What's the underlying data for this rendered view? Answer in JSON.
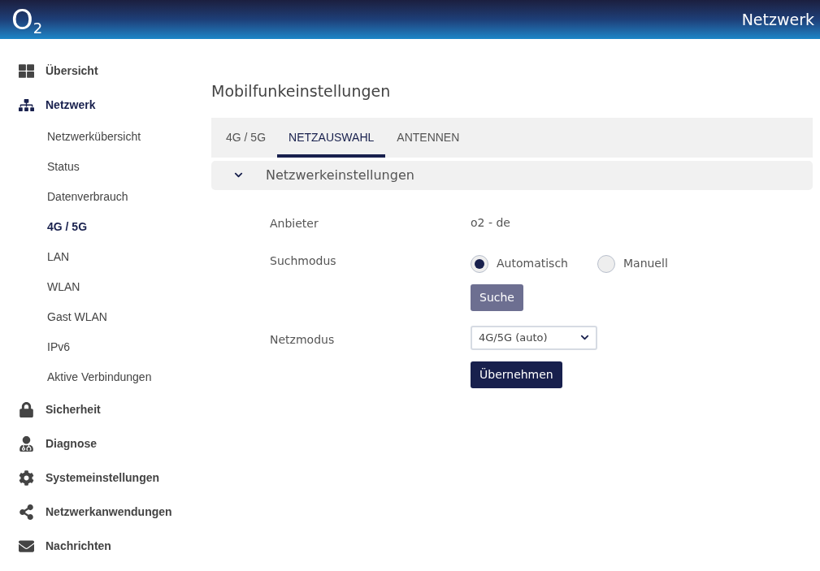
{
  "header": {
    "logo": "O$_{2}$",
    "title": "Netzwerk"
  },
  "sidebar": {
    "items": [
      {
        "label": "Übersicht",
        "selected": false
      },
      {
        "label": "Netzwerk",
        "selected": true,
        "children": [
          {
            "label": "Netzwerkübersicht",
            "selected": false
          },
          {
            "label": "Status",
            "selected": false
          },
          {
            "label": "Datenverbrauch",
            "selected": false
          },
          {
            "label": "4G / 5G",
            "selected": true
          },
          {
            "label": "LAN",
            "selected": false
          },
          {
            "label": "WLAN",
            "selected": false
          },
          {
            "label": "Gast WLAN",
            "selected": false
          },
          {
            "label": "IPv6",
            "selected": false
          },
          {
            "label": "Aktive Verbindungen",
            "selected": false
          }
        ]
      },
      {
        "label": "Sicherheit",
        "selected": false
      },
      {
        "label": "Diagnose",
        "selected": false
      },
      {
        "label": "Systemeinstellungen",
        "selected": false
      },
      {
        "label": "Netzwerkanwendungen",
        "selected": false
      },
      {
        "label": "Nachrichten",
        "selected": false
      }
    ]
  },
  "page_title": "Mobilfunkeinstellungen",
  "tabs": [
    {
      "label": "4G / 5G",
      "selected": false
    },
    {
      "label": "NETZAUSWAHL",
      "selected": true
    },
    {
      "label": "ANTENNEN",
      "selected": false
    }
  ],
  "section": {
    "title": "Netzwerkeinstellungen",
    "expanded": true
  },
  "form": [
    {
      "kind": "text",
      "label": "Anbieter",
      "value": "o2 - de"
    },
    {
      "kind": "radio",
      "label": "Suchmodus",
      "options": [
        {
          "label": "Automatisch",
          "selected": true
        },
        {
          "label": "Manuell",
          "selected": false
        }
      ],
      "button": {
        "label": "Suche",
        "disabled": true
      }
    },
    {
      "kind": "select",
      "label": "Netzmodus",
      "value": "4G/5G (auto)",
      "button": {
        "label": "Übernehmen",
        "disabled": false
      }
    }
  ]
}
